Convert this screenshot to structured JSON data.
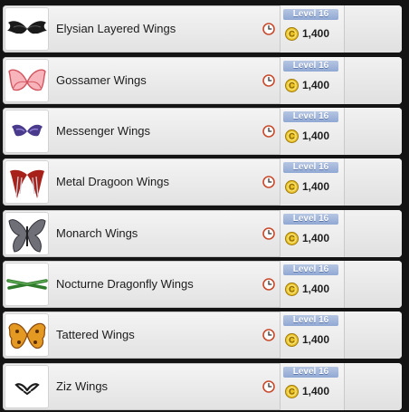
{
  "colors": {
    "level_badge": "#9cb0da",
    "coin": "#e8c124",
    "clock_ring": "#c94a2c"
  },
  "items": [
    {
      "name": "Elysian Layered Wings",
      "level": "Level 16",
      "price": "1,400",
      "icon": "black-layered-wings-icon"
    },
    {
      "name": "Gossamer Wings",
      "level": "Level 16",
      "price": "1,400",
      "icon": "pink-gossamer-wings-icon"
    },
    {
      "name": "Messenger Wings",
      "level": "Level 16",
      "price": "1,400",
      "icon": "purple-messenger-wings-icon"
    },
    {
      "name": "Metal Dragoon Wings",
      "level": "Level 16",
      "price": "1,400",
      "icon": "red-metal-dragoon-wings-icon"
    },
    {
      "name": "Monarch Wings",
      "level": "Level 16",
      "price": "1,400",
      "icon": "gray-monarch-wings-icon"
    },
    {
      "name": "Nocturne Dragonfly Wings",
      "level": "Level 16",
      "price": "1,400",
      "icon": "green-dragonfly-wings-icon"
    },
    {
      "name": "Tattered Wings",
      "level": "Level 16",
      "price": "1,400",
      "icon": "orange-tattered-wings-icon"
    },
    {
      "name": "Ziz Wings",
      "level": "Level 16",
      "price": "1,400",
      "icon": "small-white-ziz-wings-icon"
    }
  ]
}
